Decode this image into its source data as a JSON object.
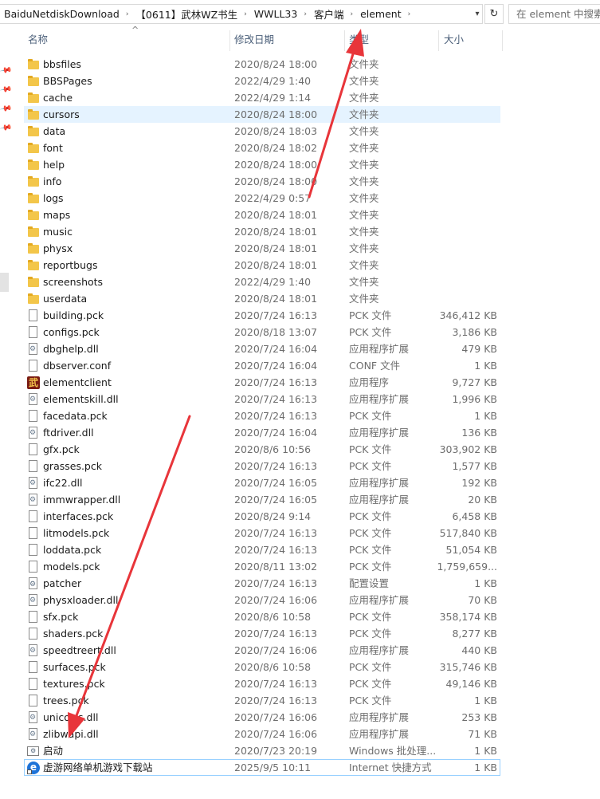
{
  "address_bar": {
    "crumbs": [
      "BaiduNetdiskDownload",
      "【0611】武林WZ书生",
      "WWLL33",
      "客户端",
      "element"
    ],
    "separator": "›",
    "dropdown_icon": "chevron-down-icon",
    "refresh_symbol": "↻"
  },
  "search": {
    "placeholder": "在 element 中搜索"
  },
  "columns": {
    "name": "名称",
    "date": "修改日期",
    "type": "类型",
    "size": "大小"
  },
  "files": [
    {
      "name": "bbsfiles",
      "date": "2020/8/24 18:00",
      "type": "文件夹",
      "size": "",
      "icon": "folder"
    },
    {
      "name": "BBSPages",
      "date": "2022/4/29 1:40",
      "type": "文件夹",
      "size": "",
      "icon": "folder"
    },
    {
      "name": "cache",
      "date": "2022/4/29 1:14",
      "type": "文件夹",
      "size": "",
      "icon": "folder"
    },
    {
      "name": "cursors",
      "date": "2020/8/24 18:00",
      "type": "文件夹",
      "size": "",
      "icon": "folder",
      "state": "hover"
    },
    {
      "name": "data",
      "date": "2020/8/24 18:03",
      "type": "文件夹",
      "size": "",
      "icon": "folder"
    },
    {
      "name": "font",
      "date": "2020/8/24 18:02",
      "type": "文件夹",
      "size": "",
      "icon": "folder"
    },
    {
      "name": "help",
      "date": "2020/8/24 18:00",
      "type": "文件夹",
      "size": "",
      "icon": "folder"
    },
    {
      "name": "info",
      "date": "2020/8/24 18:00",
      "type": "文件夹",
      "size": "",
      "icon": "folder"
    },
    {
      "name": "logs",
      "date": "2022/4/29 0:57",
      "type": "文件夹",
      "size": "",
      "icon": "folder"
    },
    {
      "name": "maps",
      "date": "2020/8/24 18:01",
      "type": "文件夹",
      "size": "",
      "icon": "folder"
    },
    {
      "name": "music",
      "date": "2020/8/24 18:01",
      "type": "文件夹",
      "size": "",
      "icon": "folder"
    },
    {
      "name": "physx",
      "date": "2020/8/24 18:01",
      "type": "文件夹",
      "size": "",
      "icon": "folder"
    },
    {
      "name": "reportbugs",
      "date": "2020/8/24 18:01",
      "type": "文件夹",
      "size": "",
      "icon": "folder"
    },
    {
      "name": "screenshots",
      "date": "2022/4/29 1:40",
      "type": "文件夹",
      "size": "",
      "icon": "folder"
    },
    {
      "name": "userdata",
      "date": "2020/8/24 18:01",
      "type": "文件夹",
      "size": "",
      "icon": "folder"
    },
    {
      "name": "building.pck",
      "date": "2020/7/24 16:13",
      "type": "PCK 文件",
      "size": "346,412 KB",
      "icon": "doc"
    },
    {
      "name": "configs.pck",
      "date": "2020/8/18 13:07",
      "type": "PCK 文件",
      "size": "3,186 KB",
      "icon": "doc"
    },
    {
      "name": "dbghelp.dll",
      "date": "2020/7/24 16:04",
      "type": "应用程序扩展",
      "size": "479 KB",
      "icon": "dll"
    },
    {
      "name": "dbserver.conf",
      "date": "2020/7/24 16:04",
      "type": "CONF 文件",
      "size": "1 KB",
      "icon": "doc"
    },
    {
      "name": "elementclient",
      "date": "2020/7/24 16:13",
      "type": "应用程序",
      "size": "9,727 KB",
      "icon": "game"
    },
    {
      "name": "elementskill.dll",
      "date": "2020/7/24 16:13",
      "type": "应用程序扩展",
      "size": "1,996 KB",
      "icon": "dll"
    },
    {
      "name": "facedata.pck",
      "date": "2020/7/24 16:13",
      "type": "PCK 文件",
      "size": "1 KB",
      "icon": "doc"
    },
    {
      "name": "ftdriver.dll",
      "date": "2020/7/24 16:04",
      "type": "应用程序扩展",
      "size": "136 KB",
      "icon": "dll"
    },
    {
      "name": "gfx.pck",
      "date": "2020/8/6 10:56",
      "type": "PCK 文件",
      "size": "303,902 KB",
      "icon": "doc"
    },
    {
      "name": "grasses.pck",
      "date": "2020/7/24 16:13",
      "type": "PCK 文件",
      "size": "1,577 KB",
      "icon": "doc"
    },
    {
      "name": "ifc22.dll",
      "date": "2020/7/24 16:05",
      "type": "应用程序扩展",
      "size": "192 KB",
      "icon": "dll"
    },
    {
      "name": "immwrapper.dll",
      "date": "2020/7/24 16:05",
      "type": "应用程序扩展",
      "size": "20 KB",
      "icon": "dll"
    },
    {
      "name": "interfaces.pck",
      "date": "2020/8/24 9:14",
      "type": "PCK 文件",
      "size": "6,458 KB",
      "icon": "doc"
    },
    {
      "name": "litmodels.pck",
      "date": "2020/7/24 16:13",
      "type": "PCK 文件",
      "size": "517,840 KB",
      "icon": "doc"
    },
    {
      "name": "loddata.pck",
      "date": "2020/7/24 16:13",
      "type": "PCK 文件",
      "size": "51,054 KB",
      "icon": "doc"
    },
    {
      "name": "models.pck",
      "date": "2020/8/11 13:02",
      "type": "PCK 文件",
      "size": "1,759,659...",
      "icon": "doc"
    },
    {
      "name": "patcher",
      "date": "2020/7/24 16:13",
      "type": "配置设置",
      "size": "1 KB",
      "icon": "cfg"
    },
    {
      "name": "physxloader.dll",
      "date": "2020/7/24 16:06",
      "type": "应用程序扩展",
      "size": "70 KB",
      "icon": "dll"
    },
    {
      "name": "sfx.pck",
      "date": "2020/8/6 10:58",
      "type": "PCK 文件",
      "size": "358,174 KB",
      "icon": "doc"
    },
    {
      "name": "shaders.pck",
      "date": "2020/7/24 16:13",
      "type": "PCK 文件",
      "size": "8,277 KB",
      "icon": "doc"
    },
    {
      "name": "speedtreert.dll",
      "date": "2020/7/24 16:06",
      "type": "应用程序扩展",
      "size": "440 KB",
      "icon": "dll"
    },
    {
      "name": "surfaces.pck",
      "date": "2020/8/6 10:58",
      "type": "PCK 文件",
      "size": "315,746 KB",
      "icon": "doc"
    },
    {
      "name": "textures.pck",
      "date": "2020/7/24 16:13",
      "type": "PCK 文件",
      "size": "49,146 KB",
      "icon": "doc"
    },
    {
      "name": "trees.pck",
      "date": "2020/7/24 16:13",
      "type": "PCK 文件",
      "size": "1 KB",
      "icon": "doc"
    },
    {
      "name": "unicows.dll",
      "date": "2020/7/24 16:06",
      "type": "应用程序扩展",
      "size": "253 KB",
      "icon": "dll"
    },
    {
      "name": "zlibwapi.dll",
      "date": "2020/7/24 16:06",
      "type": "应用程序扩展",
      "size": "71 KB",
      "icon": "dll"
    },
    {
      "name": "启动",
      "date": "2020/7/23 20:19",
      "type": "Windows 批处理...",
      "size": "1 KB",
      "icon": "bat"
    },
    {
      "name": "虚游网络单机游戏下载站",
      "date": "2025/9/5 10:11",
      "type": "Internet 快捷方式",
      "size": "1 KB",
      "icon": "web",
      "state": "selected"
    }
  ],
  "colors": {
    "hover_row": "#e5f3ff",
    "selected_border": "#99d1ff",
    "header_text": "#4c607a",
    "annotation_arrow": "#e8353a"
  }
}
